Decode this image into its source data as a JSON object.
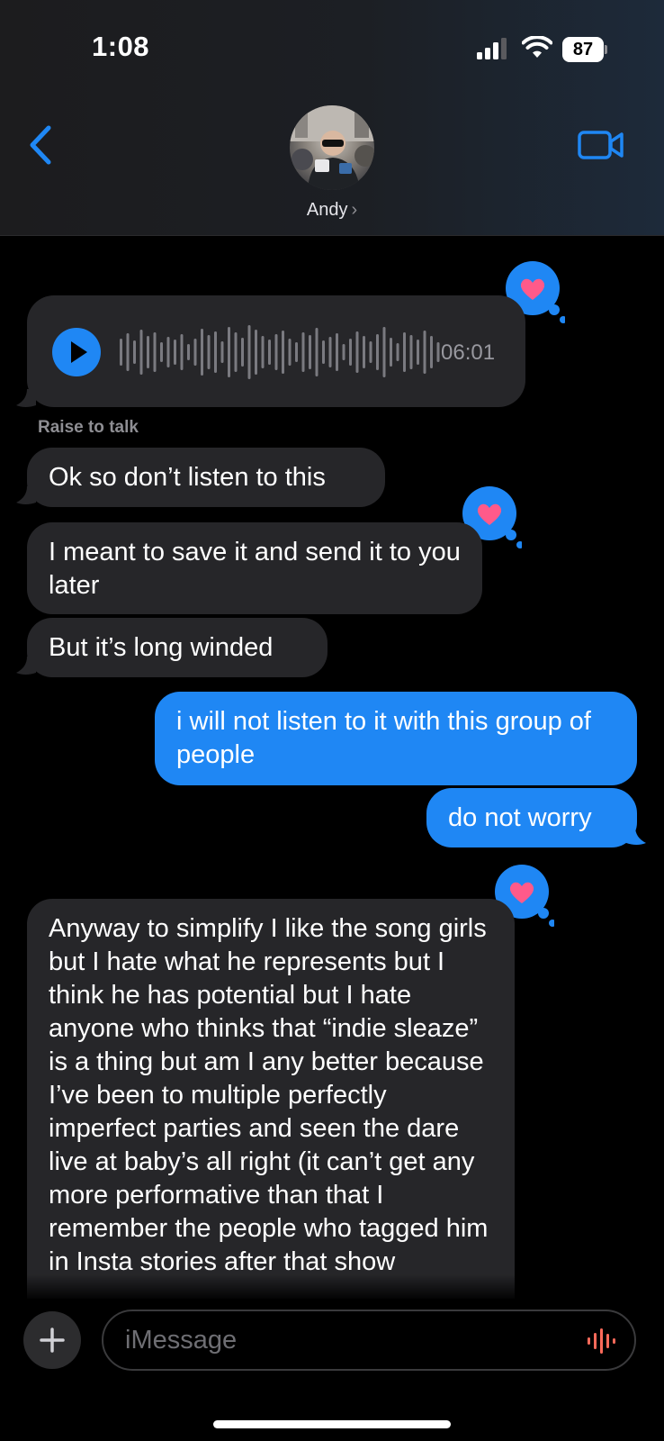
{
  "status_bar": {
    "time": "1:08",
    "battery": "87"
  },
  "header": {
    "contact_name": "Andy",
    "chevron": "›"
  },
  "icons": {
    "back": "chevron-left-icon",
    "video": "video-camera-icon",
    "play": "play-icon",
    "plus": "plus-icon",
    "mic": "waveform-mic-icon",
    "heart": "heart-tapback-icon"
  },
  "colors": {
    "accent": "#1f87f4",
    "incoming_bubble": "#262629",
    "heart": "#ff5a8a",
    "mic": "#ff6a5a"
  },
  "audio_message": {
    "duration": "06:01"
  },
  "raise_to_talk": "Raise to talk",
  "messages": [
    {
      "from": "them",
      "text": "Ok so don’t listen to this"
    },
    {
      "from": "them",
      "text": "I meant to save it  and send it to you later"
    },
    {
      "from": "them",
      "text": "But it’s long winded"
    },
    {
      "from": "me",
      "text": "i will not listen to it with this group of people"
    },
    {
      "from": "me",
      "text": "do not worry"
    },
    {
      "from": "them",
      "text": "Anyway to simplify I like the song girls but I hate what he represents but I think he has potential but I hate anyone who thinks that “indie sleaze” is a thing but am I any better because I’ve been to multiple perfectly imperfect parties and seen the dare live at baby’s all right (it can’t get any more performative than that I remember the people who tagged him in Insta stories after that show"
    }
  ],
  "input": {
    "placeholder": "iMessage",
    "value": ""
  }
}
